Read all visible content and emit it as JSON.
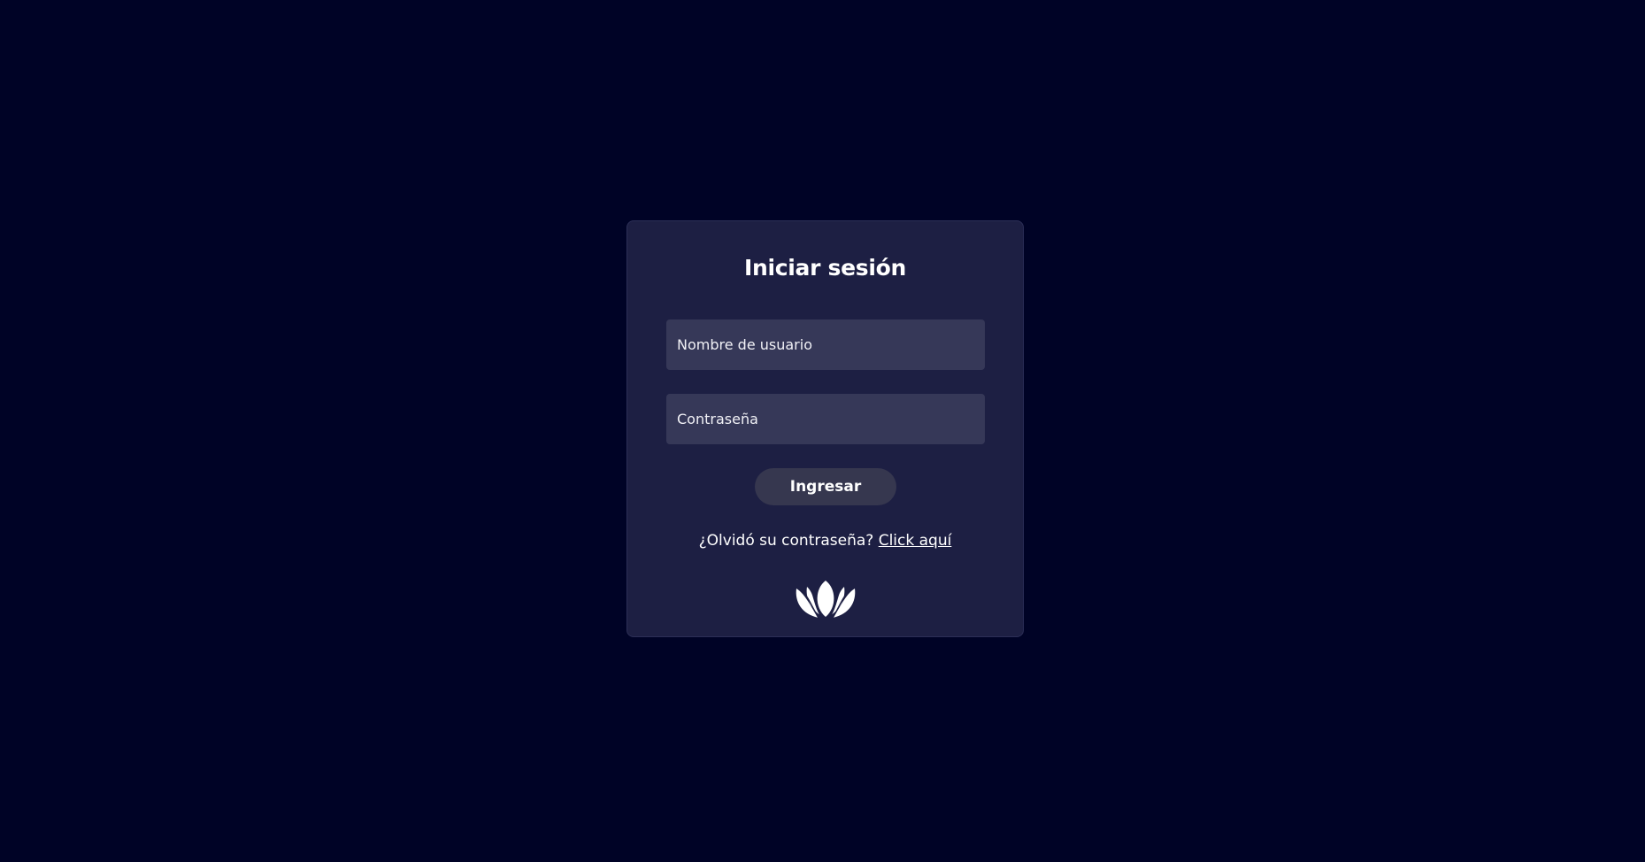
{
  "login": {
    "title": "Iniciar sesión",
    "username_placeholder": "Nombre de usuario",
    "username_value": "",
    "password_placeholder": "Contraseña",
    "password_value": "",
    "submit_label": "Ingresar",
    "forgot_text": "¿Olvidó su contraseña?",
    "forgot_link": "Click aquí",
    "logo_icon": "lotus-icon"
  },
  "colors": {
    "background": "#000326",
    "card": "#1d1f43",
    "input": "#363858",
    "button": "#36374f",
    "text": "#ffffff"
  }
}
